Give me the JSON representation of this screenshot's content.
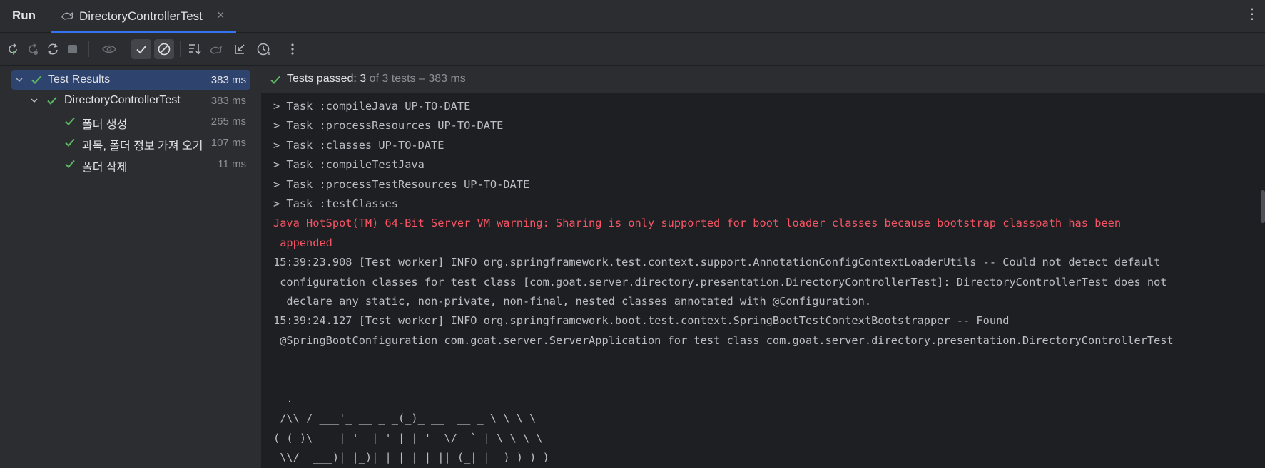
{
  "tabbar": {
    "run_label": "Run",
    "tab_title": "DirectoryControllerTest",
    "close_glyph": "×",
    "more_glyph": "⋮"
  },
  "toolbar": {
    "icons": [
      "rerun-icon",
      "rerun-failed-icon",
      "toggle-auto-test-icon",
      "stop-icon",
      "show-passed-eye-icon",
      "show-passed-check-icon",
      "show-ignored-icon",
      "sort-icon",
      "collapse-icon",
      "import-tests-icon",
      "history-icon",
      "more-icon"
    ]
  },
  "tree": {
    "items": [
      {
        "label": "Test Results",
        "time": "383 ms",
        "level": 0,
        "expanded": true,
        "selected": true
      },
      {
        "label": "DirectoryControllerTest",
        "time": "383 ms",
        "level": 1,
        "expanded": true,
        "selected": false
      },
      {
        "label": "폴더 생성",
        "time": "265 ms",
        "level": 2,
        "selected": false
      },
      {
        "label": "과목, 폴더 정보 가져 오기",
        "time": "107 ms",
        "level": 2,
        "selected": false
      },
      {
        "label": "폴더 삭제",
        "time": "11 ms",
        "level": 2,
        "selected": false
      }
    ]
  },
  "status": {
    "passed_text": "Tests passed: 3",
    "rest_text": " of 3 tests – 383 ms"
  },
  "console": {
    "lines": [
      {
        "text": "> Task :compileJava UP-TO-DATE",
        "kind": "normal"
      },
      {
        "text": "> Task :processResources UP-TO-DATE",
        "kind": "normal"
      },
      {
        "text": "> Task :classes UP-TO-DATE",
        "kind": "normal"
      },
      {
        "text": "> Task :compileTestJava",
        "kind": "normal"
      },
      {
        "text": "> Task :processTestResources UP-TO-DATE",
        "kind": "normal"
      },
      {
        "text": "> Task :testClasses",
        "kind": "normal"
      },
      {
        "text": "Java HotSpot(TM) 64-Bit Server VM warning: Sharing is only supported for boot loader classes because bootstrap classpath has been",
        "kind": "warn"
      },
      {
        "text": " appended",
        "kind": "warn"
      },
      {
        "text": "15:39:23.908 [Test worker] INFO org.springframework.test.context.support.AnnotationConfigContextLoaderUtils -- Could not detect default",
        "kind": "normal"
      },
      {
        "text": " configuration classes for test class [com.goat.server.directory.presentation.DirectoryControllerTest]: DirectoryControllerTest does not",
        "kind": "normal"
      },
      {
        "text": "  declare any static, non-private, non-final, nested classes annotated with @Configuration.",
        "kind": "normal"
      },
      {
        "text": "15:39:24.127 [Test worker] INFO org.springframework.boot.test.context.SpringBootTestContextBootstrapper -- Found",
        "kind": "normal"
      },
      {
        "text": " @SpringBootConfiguration com.goat.server.ServerApplication for test class com.goat.server.directory.presentation.DirectoryControllerTest",
        "kind": "normal"
      },
      {
        "text": "",
        "kind": "normal"
      },
      {
        "text": "",
        "kind": "normal"
      },
      {
        "text": "  .   ____          _            __ _ _",
        "kind": "normal"
      },
      {
        "text": " /\\\\ / ___'_ __ _ _(_)_ __  __ _ \\ \\ \\ \\",
        "kind": "normal"
      },
      {
        "text": "( ( )\\___ | '_ | '_| | '_ \\/ _` | \\ \\ \\ \\",
        "kind": "normal"
      },
      {
        "text": " \\\\/  ___)| |_)| | | | | || (_| |  ) ) ) )",
        "kind": "normal"
      },
      {
        "text": "  '  |____| .__|_| |_|_| |_\\__, | / / / /",
        "kind": "normal"
      }
    ]
  },
  "colors": {
    "background": "#2b2d30",
    "console_bg": "#1e1f22",
    "selection": "#2e436e",
    "accent": "#3574f0",
    "success": "#5fb865",
    "warning_text": "#f75464"
  }
}
